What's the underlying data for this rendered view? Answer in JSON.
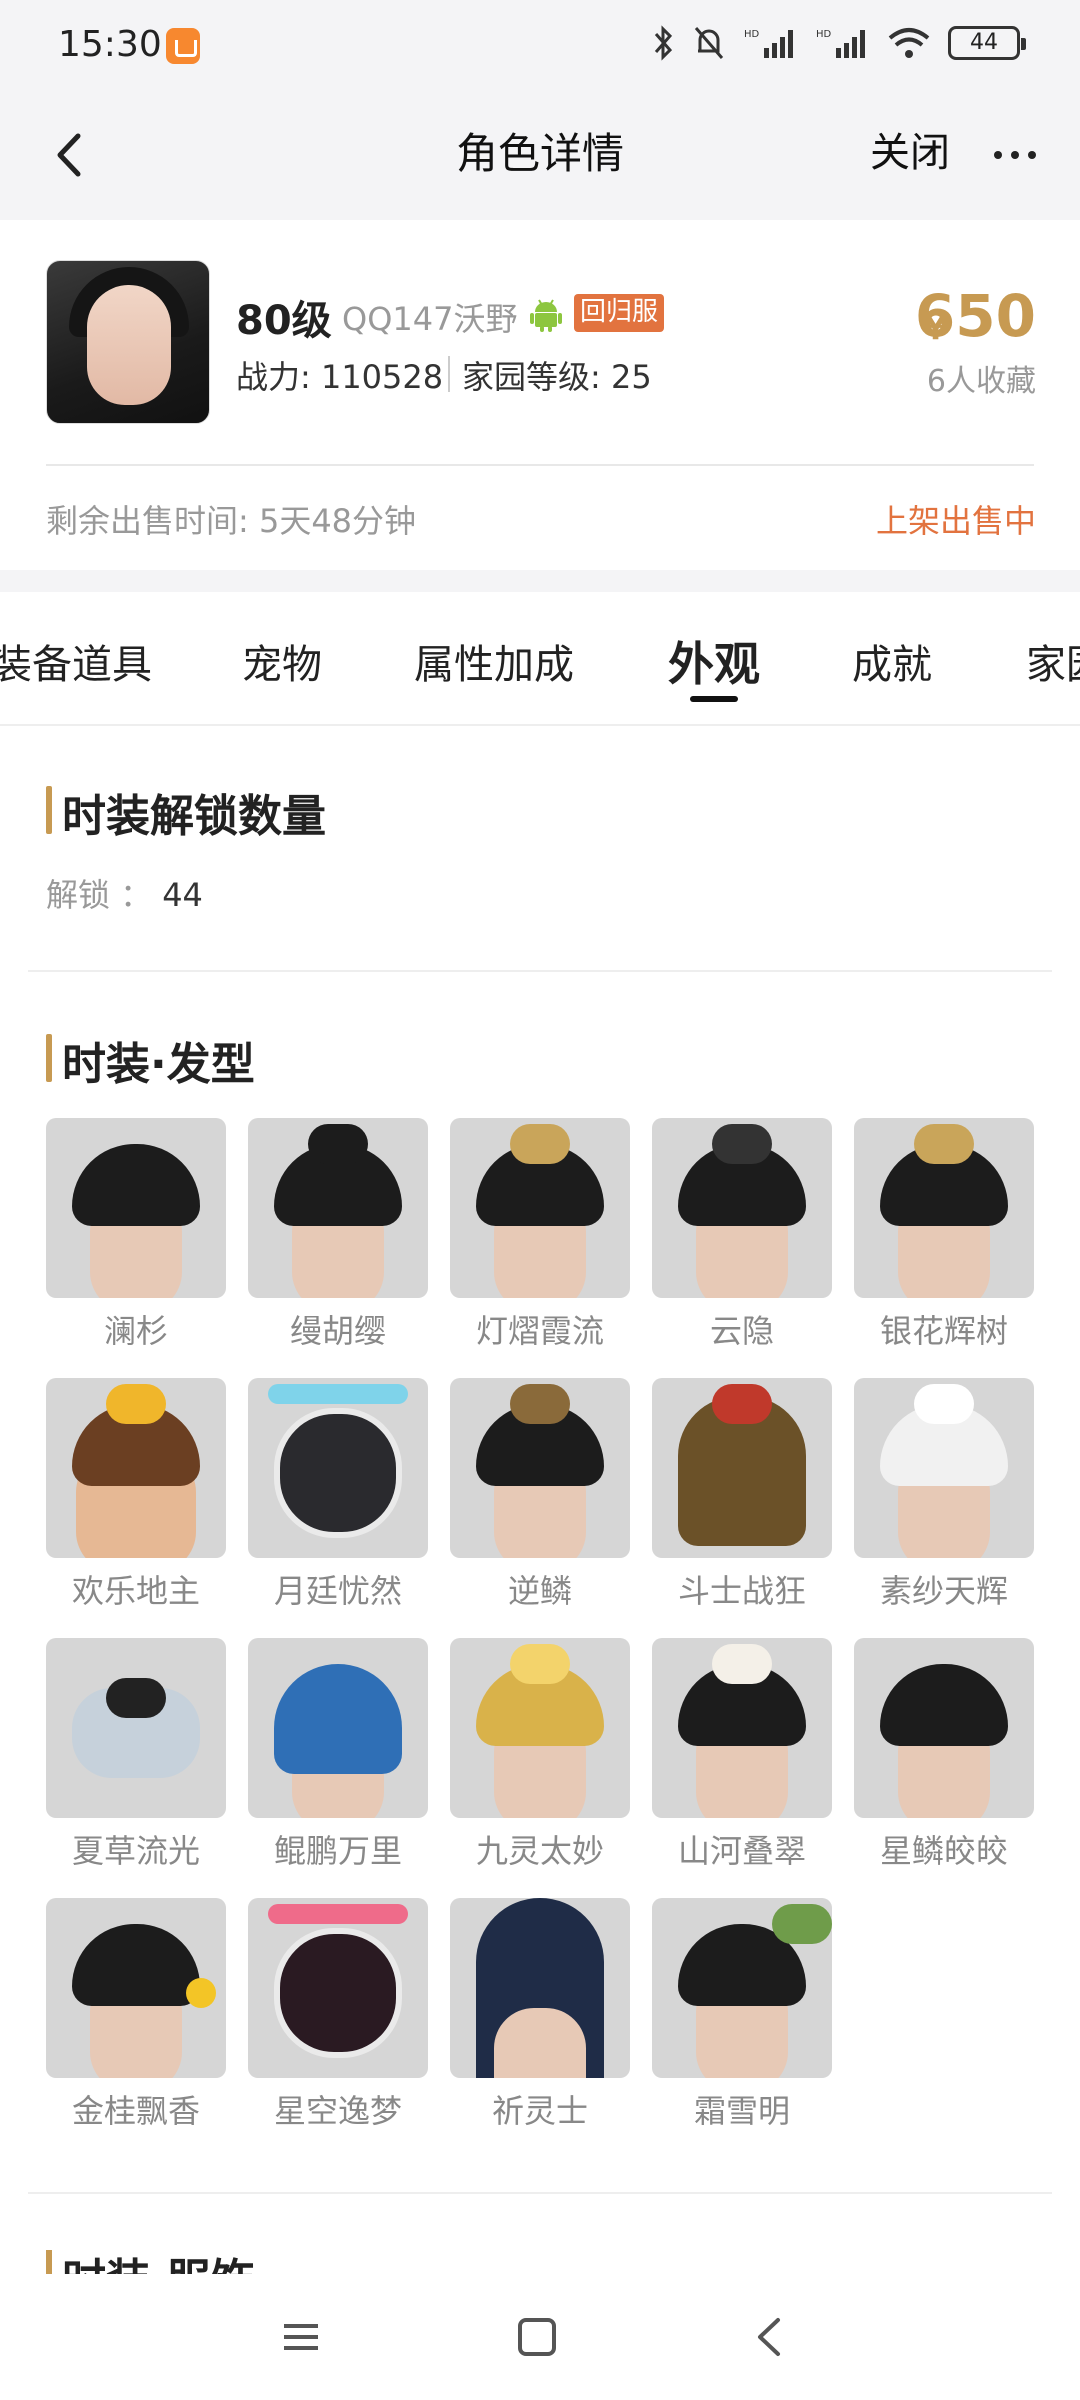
{
  "status_bar": {
    "time": "15:30",
    "battery": "44",
    "icons": [
      "app-notification-icon",
      "bluetooth-icon",
      "bell-muted-icon",
      "signal-hd-icon",
      "signal-hd-icon",
      "wifi-icon",
      "battery-icon"
    ]
  },
  "nav": {
    "back_icon": "chevron-left-icon",
    "title": "角色详情",
    "close_label": "关闭",
    "more_icon": "more-dots-icon"
  },
  "character": {
    "level": "80级",
    "server": "QQ147沃野",
    "platform_icon": "android-icon",
    "badge": "回归服",
    "power": "战力: 110528",
    "home_level": "家园等级: 25",
    "price_symbol": "¥",
    "price": "650",
    "favorites": "6人收藏",
    "remaining_time": "剩余出售时间: 5天48分钟",
    "sale_status": "上架出售中"
  },
  "tabs": [
    {
      "label": "装备道具",
      "active": false
    },
    {
      "label": "宠物",
      "active": false
    },
    {
      "label": "属性加成",
      "active": false
    },
    {
      "label": "外观",
      "active": true
    },
    {
      "label": "成就",
      "active": false
    },
    {
      "label": "家园",
      "active": false
    }
  ],
  "unlock_section": {
    "title": "时装解锁数量",
    "label": "解锁 ：",
    "value": "44"
  },
  "hairstyles": {
    "title": "时装·发型",
    "items": [
      {
        "name": "澜杉"
      },
      {
        "name": "缦胡缨"
      },
      {
        "name": "灯熠霞流"
      },
      {
        "name": "云隐"
      },
      {
        "name": "银花辉树"
      },
      {
        "name": "欢乐地主"
      },
      {
        "name": "月廷忧然"
      },
      {
        "name": "逆鳞"
      },
      {
        "name": "斗士战狂"
      },
      {
        "name": "素纱天辉"
      },
      {
        "name": "夏草流光"
      },
      {
        "name": "鲲鹏万里"
      },
      {
        "name": "九灵太妙"
      },
      {
        "name": "山河叠翠"
      },
      {
        "name": "星鳞皎皎"
      },
      {
        "name": "金桂飘香"
      },
      {
        "name": "星空逸梦"
      },
      {
        "name": "祈灵士"
      },
      {
        "name": "霜雪明"
      }
    ]
  },
  "next_section": {
    "title": "时装·服饰"
  },
  "system_nav": [
    "menu-icon",
    "home-square-icon",
    "back-icon"
  ]
}
